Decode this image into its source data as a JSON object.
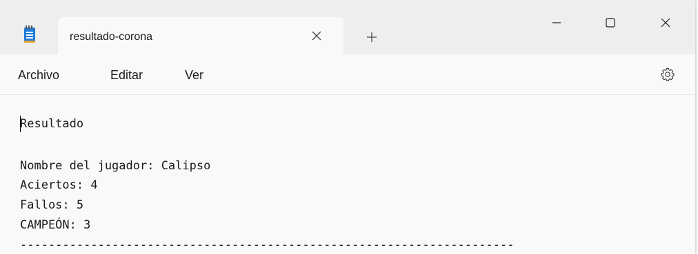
{
  "window": {
    "tab_title": "resultado-corona",
    "new_tab_glyph": "+",
    "close_tab_glyph": "×"
  },
  "menu": {
    "items": [
      "Archivo",
      "Editar",
      "Ver"
    ]
  },
  "icons": {
    "app": "notepad-icon",
    "settings": "gear-icon",
    "minimize": "minimize-icon",
    "maximize": "maximize-icon",
    "close": "close-icon"
  },
  "editor": {
    "lines": [
      "Resultado",
      "Nombre del jugador: Calipso",
      "Aciertos: 4",
      "Fallos: 5",
      "CAMPEÓN: 3",
      "----------------------------------------------------------------------"
    ]
  },
  "colors": {
    "titlebar": "#eeeeee",
    "surface": "#f9f9f9",
    "text": "#1b1b1b",
    "notepad_blue": "#1e7bd8"
  }
}
